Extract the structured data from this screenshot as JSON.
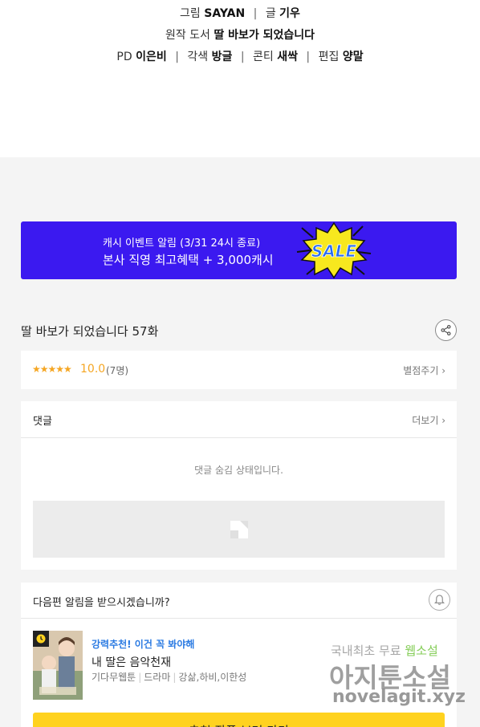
{
  "credits": {
    "line1": {
      "role1": "그림",
      "name1": "SAYAN",
      "sep": "|",
      "role2": "글",
      "name2": "기우"
    },
    "line2": {
      "role": "원작 도서",
      "name": "딸 바보가 되었습니다"
    },
    "line3": {
      "role1": "PD",
      "name1": "이은비",
      "role2": "각색",
      "name2": "방글",
      "role3": "콘티",
      "name3": "새싹",
      "role4": "편집",
      "name4": "양말",
      "sep": "|"
    }
  },
  "banner": {
    "line1": "캐시 이벤트 알림 (3/31 24시 종료)",
    "line2": "본사 직영 최고혜택 + 3,000캐시",
    "sale_text": "SALE",
    "colors": {
      "bg": "#3b19f0",
      "sale_fill": "#f7e81e",
      "sale_text": "#2a6cf0"
    }
  },
  "episode": {
    "title": "딸 바보가 되었습니다 57화",
    "share_icon": "share-icon"
  },
  "rating": {
    "stars": "★★★★★",
    "score": "10.0",
    "count": "(7명)",
    "rate_link": "별점주기 ›",
    "color": "#f5a623"
  },
  "comments": {
    "heading": "댓글",
    "more_link": "더보기 ›",
    "empty_text": "댓글 숨김 상태입니다."
  },
  "notify": {
    "question": "다음편 알림을 받으시겠습니까?",
    "bell_icon": "bell-icon"
  },
  "recommendation": {
    "tag": "강력추천! 이건 꼭 봐야해",
    "title": "내 딸은 음악천재",
    "category": "기다무웹툰",
    "genre": "드라마",
    "authors": "강삶,하비,이한성",
    "cta_label": "추천 작품 보러 가기"
  },
  "watermark": {
    "line1a": "국내최초 무료",
    "line1b": "웹소설",
    "line2": "아지툰소설",
    "line3": "novelagit.xyz"
  }
}
